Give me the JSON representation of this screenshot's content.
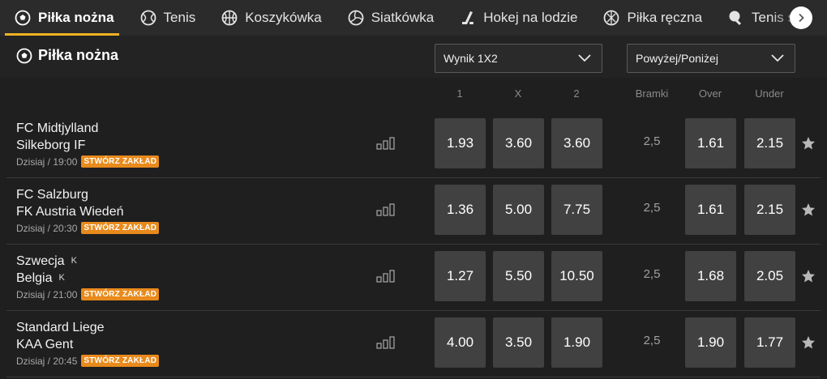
{
  "tabs": [
    {
      "label": "Piłka nożna",
      "icon": "soccer-ball-icon",
      "active": true
    },
    {
      "label": "Tenis",
      "icon": "tennis-ball-icon",
      "active": false
    },
    {
      "label": "Koszykówka",
      "icon": "basketball-icon",
      "active": false
    },
    {
      "label": "Siatkówka",
      "icon": "volleyball-icon",
      "active": false
    },
    {
      "label": "Hokej na lodzie",
      "icon": "hockey-stick-icon",
      "active": false
    },
    {
      "label": "Piłka ręczna",
      "icon": "handball-icon",
      "active": false
    },
    {
      "label": "Tenis stołowy",
      "icon": "table-tennis-icon",
      "active": false
    }
  ],
  "section": {
    "title": "Piłka nożna",
    "market_select": "Wynik 1X2",
    "ou_select": "Powyżej/Poniżej"
  },
  "columns": {
    "c1": "1",
    "cx": "X",
    "c2": "2",
    "goals": "Bramki",
    "over": "Over",
    "under": "Under"
  },
  "matches": [
    {
      "home": "FC Midtjylland",
      "home_tag": "",
      "away": "Silkeborg IF",
      "away_tag": "",
      "time": "Dzisiaj / 19:00",
      "badge": "STWÓRZ ZAKŁAD",
      "o1": "1.93",
      "ox": "3.60",
      "o2": "3.60",
      "line": "2,5",
      "over": "1.61",
      "under": "2.15"
    },
    {
      "home": "FC Salzburg",
      "home_tag": "",
      "away": "FK Austria Wiedeń",
      "away_tag": "",
      "time": "Dzisiaj / 20:30",
      "badge": "STWÓRZ ZAKŁAD",
      "o1": "1.36",
      "ox": "5.00",
      "o2": "7.75",
      "line": "2,5",
      "over": "1.61",
      "under": "2.15"
    },
    {
      "home": "Szwecja",
      "home_tag": "K",
      "away": "Belgia",
      "away_tag": "K",
      "time": "Dzisiaj / 21:00",
      "badge": "STWÓRZ ZAKŁAD",
      "o1": "1.27",
      "ox": "5.50",
      "o2": "10.50",
      "line": "2,5",
      "over": "1.68",
      "under": "2.05"
    },
    {
      "home": "Standard Liege",
      "home_tag": "",
      "away": "KAA Gent",
      "away_tag": "",
      "time": "Dzisiaj / 20:45",
      "badge": "STWÓRZ ZAKŁAD",
      "o1": "4.00",
      "ox": "3.50",
      "o2": "1.90",
      "line": "2,5",
      "over": "1.90",
      "under": "1.77"
    }
  ],
  "colors": {
    "accent": "#f0b323",
    "badge": "#e88a1c",
    "odd_bg": "#414141",
    "background": "#1f1f1f"
  }
}
